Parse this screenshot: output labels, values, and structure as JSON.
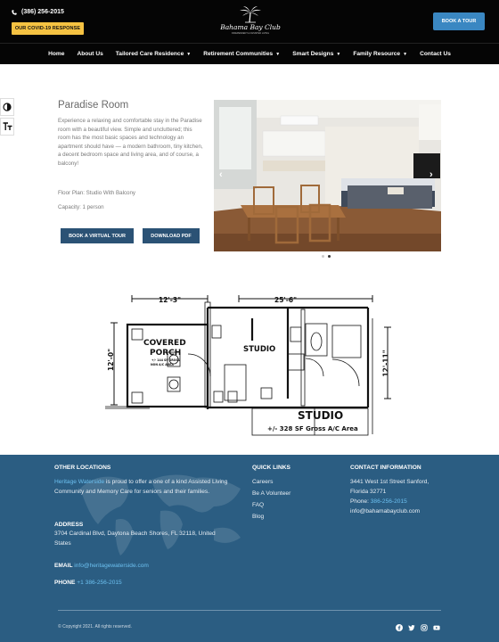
{
  "header": {
    "phone": "(386) 256-2015",
    "covid_label": "OUR COVID-19 RESPONSE",
    "logo_text": "Bahama Bay Club",
    "logo_sub": "INDEPENDENT & ASSISTED LIVING",
    "book_tour_label": "BOOK A TOUR"
  },
  "nav": {
    "items": [
      {
        "label": "Home",
        "dropdown": false
      },
      {
        "label": "About Us",
        "dropdown": false
      },
      {
        "label": "Tailored Care Residence",
        "dropdown": true
      },
      {
        "label": "Retirement Communities",
        "dropdown": true
      },
      {
        "label": "Smart Designs",
        "dropdown": true
      },
      {
        "label": "Family Resource",
        "dropdown": true
      },
      {
        "label": "Contact Us",
        "dropdown": false
      }
    ]
  },
  "room": {
    "title": "Paradise Room",
    "description": "Experience a relaxing and comfortable stay in the Paradise room with a beautiful view.  Simple and uncluttered; this room has the most basic spaces and technology an apartment should have — a modern bathroom, tiny kitchen, a decent bedroom space and living area, and of course, a balcony!",
    "floor_plan": "Floor Plan: Studio With Balcony",
    "capacity": "Capacity: 1 person",
    "virtual_tour_label": "BOOK A VIRTUAL TOUR",
    "pdf_label": "DOWNLOAD PDF",
    "carousel_dots": 2,
    "carousel_active": 2
  },
  "floorplan": {
    "dim_top_left": "12'-3\"",
    "dim_top_right": "25'-6\"",
    "dim_left": "12'-0\"",
    "dim_right": "12'-11\"",
    "porch_label_1": "COVERED",
    "porch_label_2": "PORCH",
    "porch_sub_1": "+/- 144 SF GROSS",
    "porch_sub_2": "NON A/C AREA",
    "studio_small": "STUDIO",
    "studio_big": "STUDIO",
    "studio_gross": "+/- 328 SF Gross A/C Area"
  },
  "footer": {
    "other_locations_heading": "OTHER LOCATIONS",
    "heritage_link": "Heritage Waterside",
    "heritage_text": " is proud to offer a one of a kind Assisted Living Community and Memory Care for seniors and their families.",
    "address_heading": "ADDRESS",
    "address_text": "3704 Cardinal Blvd, Daytona Beach Shores, FL 32118, United States",
    "email_heading": "EMAIL",
    "email_value": "info@heritagewaterside.com",
    "phone_heading": "PHONE",
    "phone_value": "+1 386-256-2015",
    "quick_links_heading": "QUICK LINKS",
    "quick_links": [
      "Careers",
      "Be A Volunteer",
      "FAQ",
      "Blog"
    ],
    "contact_heading": "CONTACT INFORMATION",
    "contact_address": "3441 West 1st Street Sanford, Florida 32771",
    "contact_phone_prefix": "Phone: ",
    "contact_phone": "386-256-2015",
    "contact_email": "info@bahamabayclub.com",
    "copyright": "© Copyright 2021. All rights reserved.",
    "socials": [
      "facebook-icon",
      "twitter-icon",
      "instagram-icon",
      "youtube-icon"
    ]
  },
  "colors": {
    "header_bg": "#050505",
    "covid_yellow": "#f5c242",
    "tour_blue": "#3a87c2",
    "button_navy": "#2b5275",
    "footer_bg": "#2b5d82",
    "link_blue": "#6cc0f0"
  }
}
